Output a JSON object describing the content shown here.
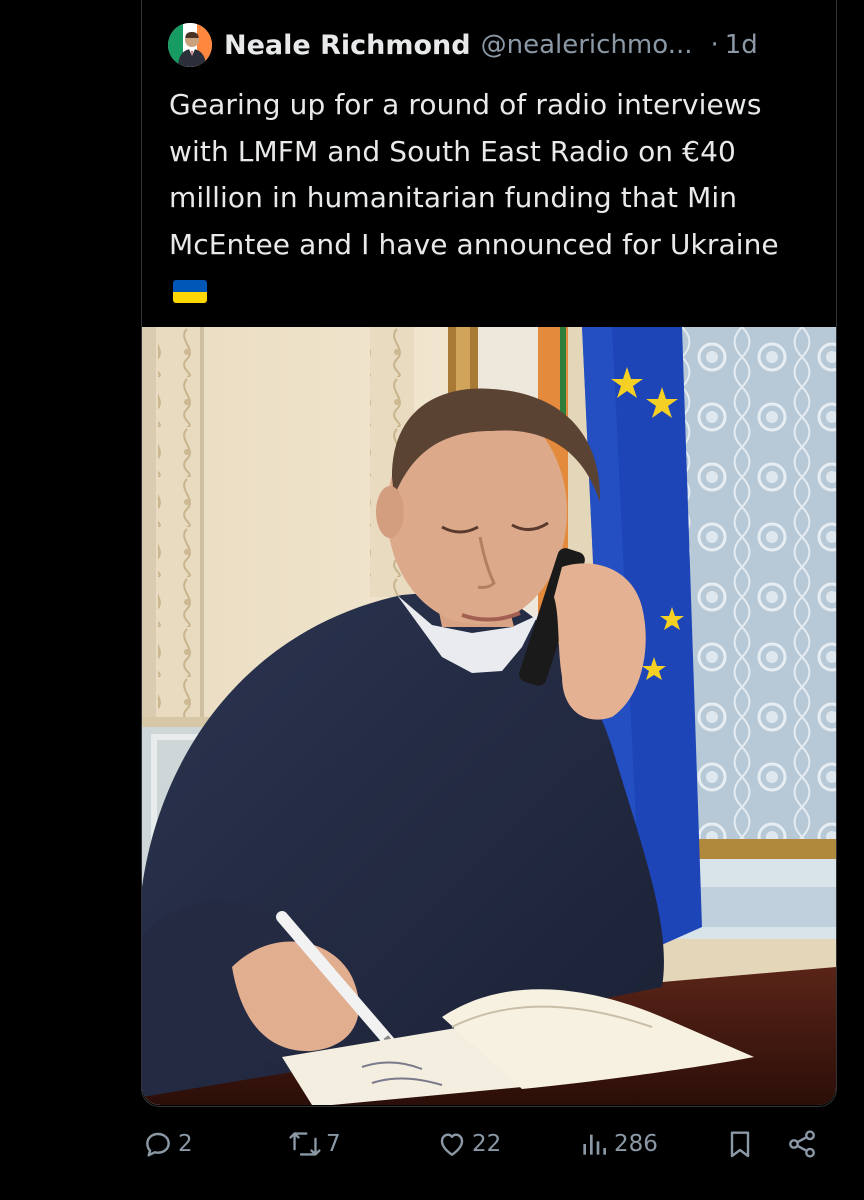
{
  "post": {
    "author": {
      "display_name": "Neale Richmond",
      "handle": "@nealerichmo...",
      "separator": "·",
      "time": "1d",
      "avatar": "avatar"
    },
    "text": "Gearing up for a round of radio interviews with LMFM and South East Radio on €40 million in humanitarian funding that Min McEntee and I have announced for Ukraine",
    "emoji": "ukraine-flag",
    "photo": "photo"
  },
  "actions": {
    "replies": {
      "icon": "reply-icon",
      "count": "2"
    },
    "reposts": {
      "icon": "repost-icon",
      "count": "7"
    },
    "likes": {
      "icon": "heart-icon",
      "count": "22"
    },
    "views": {
      "icon": "views-icon",
      "count": "286"
    },
    "bookmark": {
      "icon": "bookmark-icon"
    },
    "share": {
      "icon": "share-icon"
    }
  },
  "colors": {
    "background": "#000000",
    "text": "#e7e9ea",
    "secondary": "#8b98a5",
    "border": "#2f3336"
  }
}
